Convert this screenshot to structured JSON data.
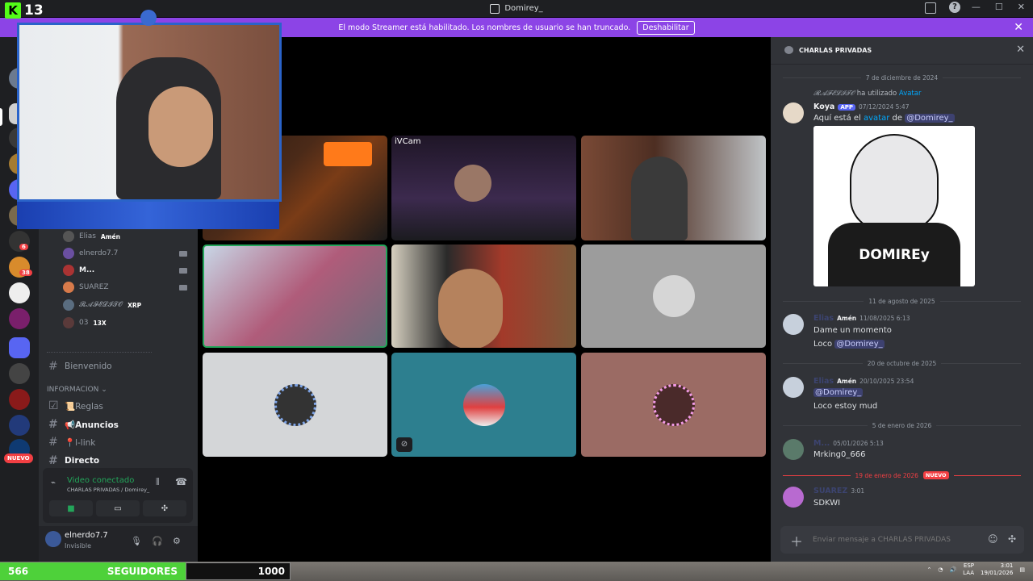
{
  "window": {
    "title": "Domirey_"
  },
  "banner": {
    "text": "El modo Streamer está habilitado. Los nombres de usuario se han truncado.",
    "button": "Deshabilitar"
  },
  "overlay": {
    "kick_count": "13",
    "follow_label": "SEGUIDORES",
    "follow_start": "566",
    "follow_goal": "1000"
  },
  "rail": {
    "badge_1": "6",
    "badge_2": "38",
    "new_label": "NUEVO"
  },
  "sidebar": {
    "voice_users": [
      {
        "name": "Elias",
        "tag": "Amén"
      },
      {
        "name": "elnerdo7.7"
      },
      {
        "name": "M..."
      },
      {
        "name": "SUAREZ"
      },
      {
        "name": "𝓡𝓐𝓕𝓔𝓛𝓘𝓣𝓞",
        "tag": "XRP"
      },
      {
        "name": "03",
        "tag": "13X"
      }
    ],
    "channels": [
      {
        "label": "Bienvenido"
      },
      {
        "label": "📜Reglas"
      },
      {
        "label": "📢Anuncios"
      },
      {
        "label": "📍l-link"
      },
      {
        "label": "Directo"
      }
    ],
    "category": "INFORMACION"
  },
  "voice_panel": {
    "status": "Video conectado",
    "location": "CHARLAS PRIVADAS / Domirey_"
  },
  "user": {
    "name": "elnerdo7.7",
    "status": "Invisible"
  },
  "video": {
    "tile_label": "iVCam"
  },
  "dm": {
    "header": "CHARLAS PRIVADAS",
    "date_1": "7 de diciembre de 2024",
    "reply_user": "𝓡𝓐𝓕𝓔𝓛𝓘𝓣𝓞",
    "reply_used": "ha utilizado",
    "reply_link": "Avatar",
    "msg1_name": "Koya",
    "msg1_app": "APP",
    "msg1_time": "07/12/2024 5:47",
    "msg1_pre": "Aquí está el",
    "msg1_link": "avatar",
    "msg1_mid": "de",
    "msg1_mention": "@Domirey_",
    "msg1_image_text": "DOMIREy",
    "date_2": "11 de agosto de 2025",
    "msg2_name": "Elias",
    "msg2_role": "Amén",
    "msg2_time": "11/08/2025 6:13",
    "msg2_line1": "Dame un momento",
    "msg2_line2_pre": "Loco",
    "msg2_mention": "@Domirey_",
    "date_3": "20 de octubre de 2025",
    "msg3_name": "Elias",
    "msg3_role": "Amén",
    "msg3_time": "20/10/2025 23:54",
    "msg3_mention": "@Domirey_",
    "msg3_line2": "Loco estoy mud",
    "date_4": "5 de enero de 2026",
    "msg4_name": "M...",
    "msg4_time": "05/01/2026 5:13",
    "msg4_body": "Mrking0_666",
    "date_5": "19 de enero de 2026",
    "new_tag": "NUEVO",
    "msg5_name": "SUAREZ",
    "msg5_time": "3:01",
    "msg5_body": "SDKWI",
    "composer_placeholder": "Enviar mensaje a CHARLAS PRIVADAS"
  },
  "tray": {
    "lang": "ESP",
    "layout": "LAA",
    "time": "3:01",
    "date": "19/01/2026"
  }
}
